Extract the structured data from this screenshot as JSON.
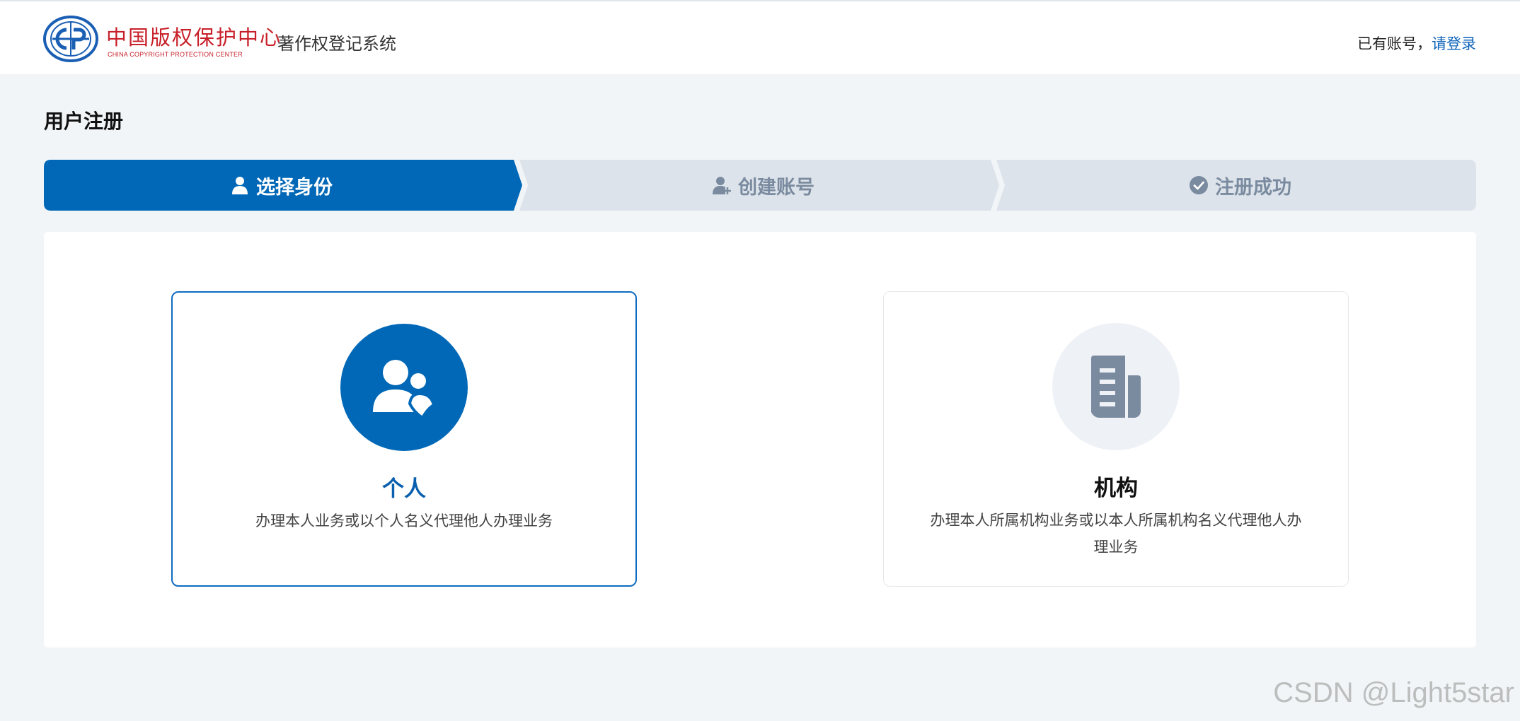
{
  "header": {
    "logo_cn": "中国版权保护中心",
    "logo_en": "CHINA COPYRIGHT PROTECTION CENTER",
    "system_name": "著作权登记系统",
    "login_prompt": "已有账号，",
    "login_link": "请登录"
  },
  "page": {
    "title": "用户注册"
  },
  "steps": [
    {
      "label": "选择身份",
      "state": "active",
      "icon": "user-icon"
    },
    {
      "label": "创建账号",
      "state": "inactive",
      "icon": "user-add-icon"
    },
    {
      "label": "注册成功",
      "state": "inactive",
      "icon": "check-circle-icon"
    }
  ],
  "options": [
    {
      "title": "个人",
      "desc": "办理本人业务或以个人名义代理他人办理业务",
      "icon": "users-icon",
      "selected": true
    },
    {
      "title": "机构",
      "desc": "办理本人所属机构业务或以本人所属机构名义代理他人办理业务",
      "icon": "building-icon",
      "selected": false
    }
  ],
  "watermark": "CSDN @Light5star",
  "colors": {
    "primary": "#0068b7",
    "step_inactive_bg": "#dde3ea",
    "step_inactive_text": "#7a8ba0",
    "background": "#f2f5f8",
    "logo_red": "#c8202a"
  }
}
